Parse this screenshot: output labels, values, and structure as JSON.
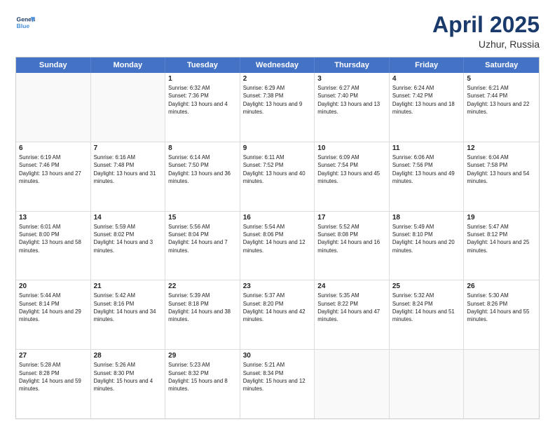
{
  "header": {
    "logo_line1": "General",
    "logo_line2": "Blue",
    "month": "April 2025",
    "location": "Uzhur, Russia"
  },
  "weekdays": [
    "Sunday",
    "Monday",
    "Tuesday",
    "Wednesday",
    "Thursday",
    "Friday",
    "Saturday"
  ],
  "rows": [
    [
      {
        "day": "",
        "sunrise": "",
        "sunset": "",
        "daylight": ""
      },
      {
        "day": "",
        "sunrise": "",
        "sunset": "",
        "daylight": ""
      },
      {
        "day": "1",
        "sunrise": "Sunrise: 6:32 AM",
        "sunset": "Sunset: 7:36 PM",
        "daylight": "Daylight: 13 hours and 4 minutes."
      },
      {
        "day": "2",
        "sunrise": "Sunrise: 6:29 AM",
        "sunset": "Sunset: 7:38 PM",
        "daylight": "Daylight: 13 hours and 9 minutes."
      },
      {
        "day": "3",
        "sunrise": "Sunrise: 6:27 AM",
        "sunset": "Sunset: 7:40 PM",
        "daylight": "Daylight: 13 hours and 13 minutes."
      },
      {
        "day": "4",
        "sunrise": "Sunrise: 6:24 AM",
        "sunset": "Sunset: 7:42 PM",
        "daylight": "Daylight: 13 hours and 18 minutes."
      },
      {
        "day": "5",
        "sunrise": "Sunrise: 6:21 AM",
        "sunset": "Sunset: 7:44 PM",
        "daylight": "Daylight: 13 hours and 22 minutes."
      }
    ],
    [
      {
        "day": "6",
        "sunrise": "Sunrise: 6:19 AM",
        "sunset": "Sunset: 7:46 PM",
        "daylight": "Daylight: 13 hours and 27 minutes."
      },
      {
        "day": "7",
        "sunrise": "Sunrise: 6:16 AM",
        "sunset": "Sunset: 7:48 PM",
        "daylight": "Daylight: 13 hours and 31 minutes."
      },
      {
        "day": "8",
        "sunrise": "Sunrise: 6:14 AM",
        "sunset": "Sunset: 7:50 PM",
        "daylight": "Daylight: 13 hours and 36 minutes."
      },
      {
        "day": "9",
        "sunrise": "Sunrise: 6:11 AM",
        "sunset": "Sunset: 7:52 PM",
        "daylight": "Daylight: 13 hours and 40 minutes."
      },
      {
        "day": "10",
        "sunrise": "Sunrise: 6:09 AM",
        "sunset": "Sunset: 7:54 PM",
        "daylight": "Daylight: 13 hours and 45 minutes."
      },
      {
        "day": "11",
        "sunrise": "Sunrise: 6:06 AM",
        "sunset": "Sunset: 7:56 PM",
        "daylight": "Daylight: 13 hours and 49 minutes."
      },
      {
        "day": "12",
        "sunrise": "Sunrise: 6:04 AM",
        "sunset": "Sunset: 7:58 PM",
        "daylight": "Daylight: 13 hours and 54 minutes."
      }
    ],
    [
      {
        "day": "13",
        "sunrise": "Sunrise: 6:01 AM",
        "sunset": "Sunset: 8:00 PM",
        "daylight": "Daylight: 13 hours and 58 minutes."
      },
      {
        "day": "14",
        "sunrise": "Sunrise: 5:59 AM",
        "sunset": "Sunset: 8:02 PM",
        "daylight": "Daylight: 14 hours and 3 minutes."
      },
      {
        "day": "15",
        "sunrise": "Sunrise: 5:56 AM",
        "sunset": "Sunset: 8:04 PM",
        "daylight": "Daylight: 14 hours and 7 minutes."
      },
      {
        "day": "16",
        "sunrise": "Sunrise: 5:54 AM",
        "sunset": "Sunset: 8:06 PM",
        "daylight": "Daylight: 14 hours and 12 minutes."
      },
      {
        "day": "17",
        "sunrise": "Sunrise: 5:52 AM",
        "sunset": "Sunset: 8:08 PM",
        "daylight": "Daylight: 14 hours and 16 minutes."
      },
      {
        "day": "18",
        "sunrise": "Sunrise: 5:49 AM",
        "sunset": "Sunset: 8:10 PM",
        "daylight": "Daylight: 14 hours and 20 minutes."
      },
      {
        "day": "19",
        "sunrise": "Sunrise: 5:47 AM",
        "sunset": "Sunset: 8:12 PM",
        "daylight": "Daylight: 14 hours and 25 minutes."
      }
    ],
    [
      {
        "day": "20",
        "sunrise": "Sunrise: 5:44 AM",
        "sunset": "Sunset: 8:14 PM",
        "daylight": "Daylight: 14 hours and 29 minutes."
      },
      {
        "day": "21",
        "sunrise": "Sunrise: 5:42 AM",
        "sunset": "Sunset: 8:16 PM",
        "daylight": "Daylight: 14 hours and 34 minutes."
      },
      {
        "day": "22",
        "sunrise": "Sunrise: 5:39 AM",
        "sunset": "Sunset: 8:18 PM",
        "daylight": "Daylight: 14 hours and 38 minutes."
      },
      {
        "day": "23",
        "sunrise": "Sunrise: 5:37 AM",
        "sunset": "Sunset: 8:20 PM",
        "daylight": "Daylight: 14 hours and 42 minutes."
      },
      {
        "day": "24",
        "sunrise": "Sunrise: 5:35 AM",
        "sunset": "Sunset: 8:22 PM",
        "daylight": "Daylight: 14 hours and 47 minutes."
      },
      {
        "day": "25",
        "sunrise": "Sunrise: 5:32 AM",
        "sunset": "Sunset: 8:24 PM",
        "daylight": "Daylight: 14 hours and 51 minutes."
      },
      {
        "day": "26",
        "sunrise": "Sunrise: 5:30 AM",
        "sunset": "Sunset: 8:26 PM",
        "daylight": "Daylight: 14 hours and 55 minutes."
      }
    ],
    [
      {
        "day": "27",
        "sunrise": "Sunrise: 5:28 AM",
        "sunset": "Sunset: 8:28 PM",
        "daylight": "Daylight: 14 hours and 59 minutes."
      },
      {
        "day": "28",
        "sunrise": "Sunrise: 5:26 AM",
        "sunset": "Sunset: 8:30 PM",
        "daylight": "Daylight: 15 hours and 4 minutes."
      },
      {
        "day": "29",
        "sunrise": "Sunrise: 5:23 AM",
        "sunset": "Sunset: 8:32 PM",
        "daylight": "Daylight: 15 hours and 8 minutes."
      },
      {
        "day": "30",
        "sunrise": "Sunrise: 5:21 AM",
        "sunset": "Sunset: 8:34 PM",
        "daylight": "Daylight: 15 hours and 12 minutes."
      },
      {
        "day": "",
        "sunrise": "",
        "sunset": "",
        "daylight": ""
      },
      {
        "day": "",
        "sunrise": "",
        "sunset": "",
        "daylight": ""
      },
      {
        "day": "",
        "sunrise": "",
        "sunset": "",
        "daylight": ""
      }
    ]
  ]
}
